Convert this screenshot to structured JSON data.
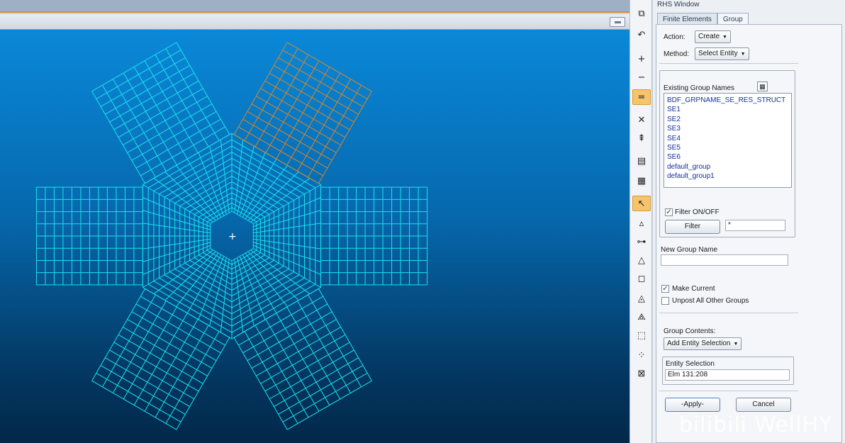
{
  "panel": {
    "title": "RHS Window",
    "tabs": [
      {
        "label": "Finite Elements"
      },
      {
        "label": "Group"
      }
    ],
    "action": {
      "label": "Action:",
      "value": "Create"
    },
    "method": {
      "label": "Method:",
      "value": "Select Entity"
    },
    "existing_groups": {
      "label": "Existing Group Names",
      "items": [
        "BDF_GRPNAME_SE_RES_STRUCT",
        "SE1",
        "SE2",
        "SE3",
        "SE4",
        "SE5",
        "SE6",
        "default_group",
        "default_group1"
      ]
    },
    "filter": {
      "checkbox_label": "Filter ON/OFF",
      "checked": true,
      "button_label": "Filter",
      "value": "*"
    },
    "new_group": {
      "label": "New Group Name",
      "value": ""
    },
    "make_current": {
      "label": "Make Current",
      "checked": true
    },
    "unpost_others": {
      "label": "Unpost All Other Groups",
      "checked": false
    },
    "group_contents": {
      "label": "Group Contents:",
      "value": "Add Entity Selection"
    },
    "entity_selection": {
      "label": "Entity Selection",
      "value": "Elm 131:208"
    },
    "apply_label": "-Apply-",
    "cancel_label": "Cancel"
  },
  "toolbar": {
    "icons": [
      {
        "name": "window-icon",
        "glyph": "⧉",
        "active": false
      },
      {
        "name": "rotate-icon",
        "glyph": "↶",
        "active": false
      },
      {
        "name": "add-icon",
        "glyph": "+",
        "active": false
      },
      {
        "name": "remove-icon",
        "glyph": "−",
        "active": false
      },
      {
        "name": "replace-icon",
        "glyph": "=",
        "active": true
      },
      {
        "name": "delete-icon",
        "glyph": "✕",
        "active": false
      },
      {
        "name": "show-icon",
        "glyph": "⇞",
        "active": false
      },
      {
        "name": "group-list-icon",
        "glyph": "▤",
        "active": false
      },
      {
        "name": "group-list2-icon",
        "glyph": "▦",
        "active": false
      },
      {
        "name": "pick-arrow-icon",
        "glyph": "↖",
        "active": true
      },
      {
        "name": "node-icon",
        "glyph": "▵",
        "active": false
      },
      {
        "name": "bar-icon",
        "glyph": "⊶",
        "active": false
      },
      {
        "name": "tria-icon",
        "glyph": "△",
        "active": false
      },
      {
        "name": "quad-icon",
        "glyph": "◻",
        "active": false
      },
      {
        "name": "tet-icon",
        "glyph": "◬",
        "active": false
      },
      {
        "name": "pyramid-icon",
        "glyph": "⟁",
        "active": false
      },
      {
        "name": "hex-icon",
        "glyph": "⬚",
        "active": false
      },
      {
        "name": "select-nodes-icon",
        "glyph": "⁘",
        "active": false
      },
      {
        "name": "select-box-icon",
        "glyph": "⊠",
        "active": false
      }
    ]
  },
  "viewport": {
    "mesh_color": "#19e3f0",
    "highlight_color": "#d6862a"
  },
  "watermark": "bilibili WellHY"
}
